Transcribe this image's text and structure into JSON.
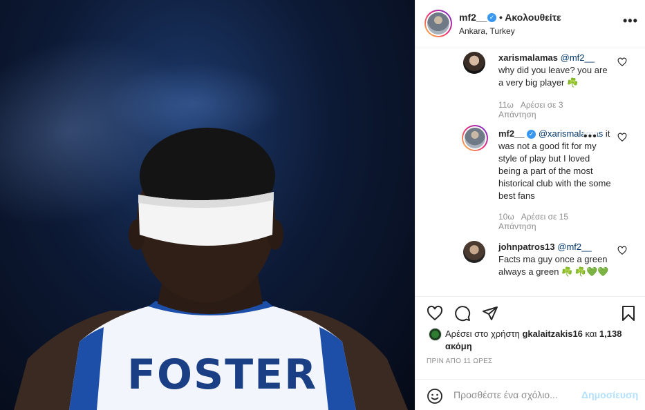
{
  "post": {
    "jersey_text": "FOSTER"
  },
  "header": {
    "username": "mf2__",
    "verified_mark": "✓",
    "follow_label": "• Ακολουθείτε",
    "location": "Ankara, Turkey",
    "more_label": "•••"
  },
  "comments": [
    {
      "username": "xarismalamas",
      "mention": "@mf2__",
      "text": "why did you leave? you are a very big player ☘️",
      "time": "11ω",
      "likes": "Αρέσει σε 3",
      "reply": "Απάντηση"
    },
    {
      "username": "mf2__",
      "mention": "@xarismalamas",
      "text": "it was not a good fit for my style of play but I loved being a part of the most historical club with the some best fans",
      "time": "10ω",
      "likes": "Αρέσει σε 15",
      "reply": "Απάντηση",
      "more_label": "•••"
    },
    {
      "username": "johnpatros13",
      "mention": "@mf2__",
      "text": "Facts ma guy once a green always a green ☘️ ☘️💚💚"
    }
  ],
  "likes": {
    "prefix": "Αρέσει στο χρήστη",
    "user": "gkalaitzakis16",
    "middle": "και",
    "count": "1,138 ακόμη"
  },
  "timestamp": "ΠΡΙΝ ΑΠΟ 11 ΩΡΕΣ",
  "add_comment": {
    "placeholder": "Προσθέστε ένα σχόλιο...",
    "post_label": "Δημοσίευση"
  },
  "colors": {
    "accent_blue": "#0095f6",
    "verified_blue": "#3897f0",
    "disabled_post": "#b2dffc",
    "muted_text": "#8e8e8e"
  }
}
